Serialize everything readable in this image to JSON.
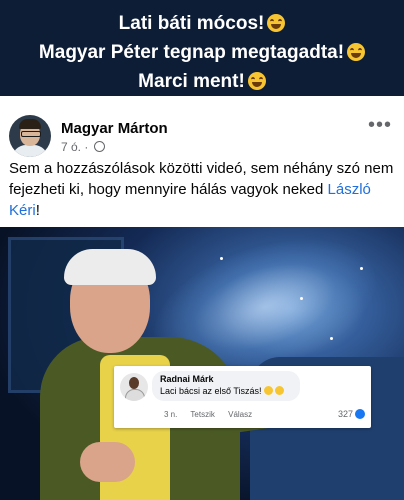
{
  "banner": {
    "line1": "Lati báti mócos!",
    "line2": "Magyar Péter tegnap megtagadta!",
    "line3": "Marci ment!",
    "emoji1": "crying-laughing-emoji",
    "emoji2": "grinning-sweat-emoji",
    "emoji3": "grinning-sweat-emoji",
    "background": "#0e1d36"
  },
  "post": {
    "author": "Magyar Márton",
    "time": "7 ó. ·",
    "more_label": "•••",
    "text_before": "Sem a hozzászólások közötti videó, sem néhány szó nem fejezheti ki, hogy mennyire hálás vagyok neked ",
    "link_text": "László Kéri",
    "text_after": "!",
    "link_color": "#216fdb"
  },
  "comment": {
    "name": "Radnai Márk",
    "text": "Laci bácsi az első Tiszás!",
    "time": "3 n.",
    "like_action": "Tetszik",
    "reply_action": "Válasz",
    "like_count": "327"
  }
}
